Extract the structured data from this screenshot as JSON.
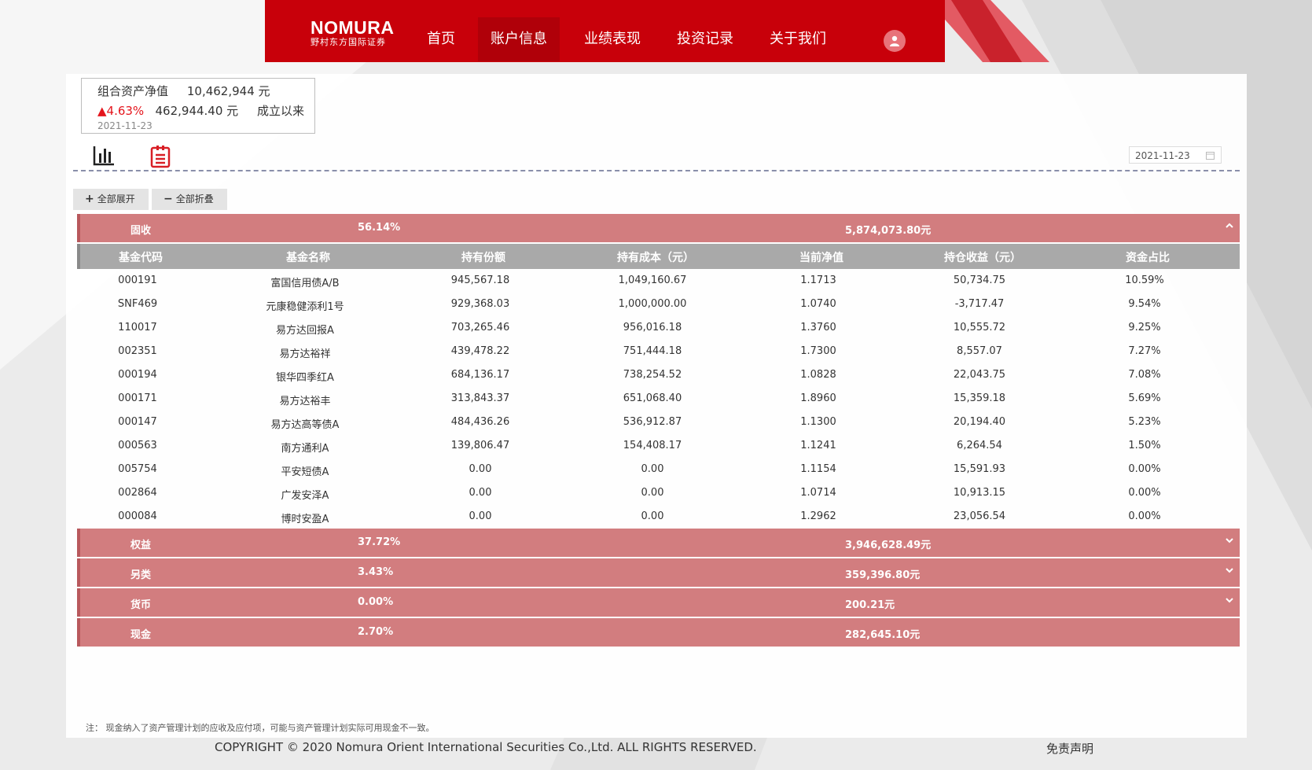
{
  "header": {
    "logo_brand": "NOMURA",
    "logo_sub": "野村东方国际证券",
    "nav": [
      "首页",
      "账户信息",
      "业绩表现",
      "投资记录",
      "关于我们"
    ],
    "active_nav": "账户信息"
  },
  "summary": {
    "label": "组合资产净值",
    "value": "10,462,944 元",
    "change_pct": "▲4.63%",
    "change_amount": "462,944.40 元",
    "since_label": "成立以来",
    "date": "2021-11-23"
  },
  "date_picker": {
    "value": "2021-11-23"
  },
  "controls": {
    "expand_all": "全部展开",
    "collapse_all": "全部折叠"
  },
  "groups": [
    {
      "name": "固收",
      "pct": "56.14%",
      "amount": "5,874,073.80元",
      "expanded": true
    },
    {
      "name": "权益",
      "pct": "37.72%",
      "amount": "3,946,628.49元",
      "expanded": false
    },
    {
      "name": "另类",
      "pct": "3.43%",
      "amount": "359,396.80元",
      "expanded": false
    },
    {
      "name": "货币",
      "pct": "0.00%",
      "amount": "200.21元",
      "expanded": false
    },
    {
      "name": "现金",
      "pct": "2.70%",
      "amount": "282,645.10元",
      "expanded": false
    }
  ],
  "table": {
    "columns": [
      "基金代码",
      "基金名称",
      "持有份额",
      "持有成本（元）",
      "当前净值",
      "持仓收益（元）",
      "资金占比"
    ],
    "rows": [
      [
        "000191",
        "富国信用债A/B",
        "945,567.18",
        "1,049,160.67",
        "1.1713",
        "50,734.75",
        "10.59%"
      ],
      [
        "SNF469",
        "元康稳健添利1号",
        "929,368.03",
        "1,000,000.00",
        "1.0740",
        "-3,717.47",
        "9.54%"
      ],
      [
        "110017",
        "易方达回报A",
        "703,265.46",
        "956,016.18",
        "1.3760",
        "10,555.72",
        "9.25%"
      ],
      [
        "002351",
        "易方达裕祥",
        "439,478.22",
        "751,444.18",
        "1.7300",
        "8,557.07",
        "7.27%"
      ],
      [
        "000194",
        "银华四季红A",
        "684,136.17",
        "738,254.52",
        "1.0828",
        "22,043.75",
        "7.08%"
      ],
      [
        "000171",
        "易方达裕丰",
        "313,843.37",
        "651,068.40",
        "1.8960",
        "15,359.18",
        "5.69%"
      ],
      [
        "000147",
        "易方达高等债A",
        "484,436.26",
        "536,912.87",
        "1.1300",
        "20,194.40",
        "5.23%"
      ],
      [
        "000563",
        "南方通利A",
        "139,806.47",
        "154,408.17",
        "1.1241",
        "6,264.54",
        "1.50%"
      ],
      [
        "005754",
        "平安短债A",
        "0.00",
        "0.00",
        "1.1154",
        "15,591.93",
        "0.00%"
      ],
      [
        "002864",
        "广发安泽A",
        "0.00",
        "0.00",
        "1.0714",
        "10,913.15",
        "0.00%"
      ],
      [
        "000084",
        "博时安盈A",
        "0.00",
        "0.00",
        "1.2962",
        "23,056.54",
        "0.00%"
      ]
    ]
  },
  "note": "注：  现金纳入了资产管理计划的应收及应付项，可能与资产管理计划实际可用现金不一致。",
  "footer": {
    "copyright": "COPYRIGHT © 2020 Nomura Orient International Securities Co.,Ltd. ALL RIGHTS RESERVED.",
    "disclaimer": "免责声明"
  },
  "colors": {
    "brand_red": "#c8000a",
    "group_row": "#d27d7f",
    "header_row": "#a9a9a9",
    "up_red": "#e4151c"
  },
  "icons": {
    "chart": "bar-chart-icon",
    "list": "list-icon",
    "user": "user-icon",
    "calendar": "calendar-icon",
    "expand": "chevron-up-icon",
    "collapse": "chevron-down-icon"
  }
}
